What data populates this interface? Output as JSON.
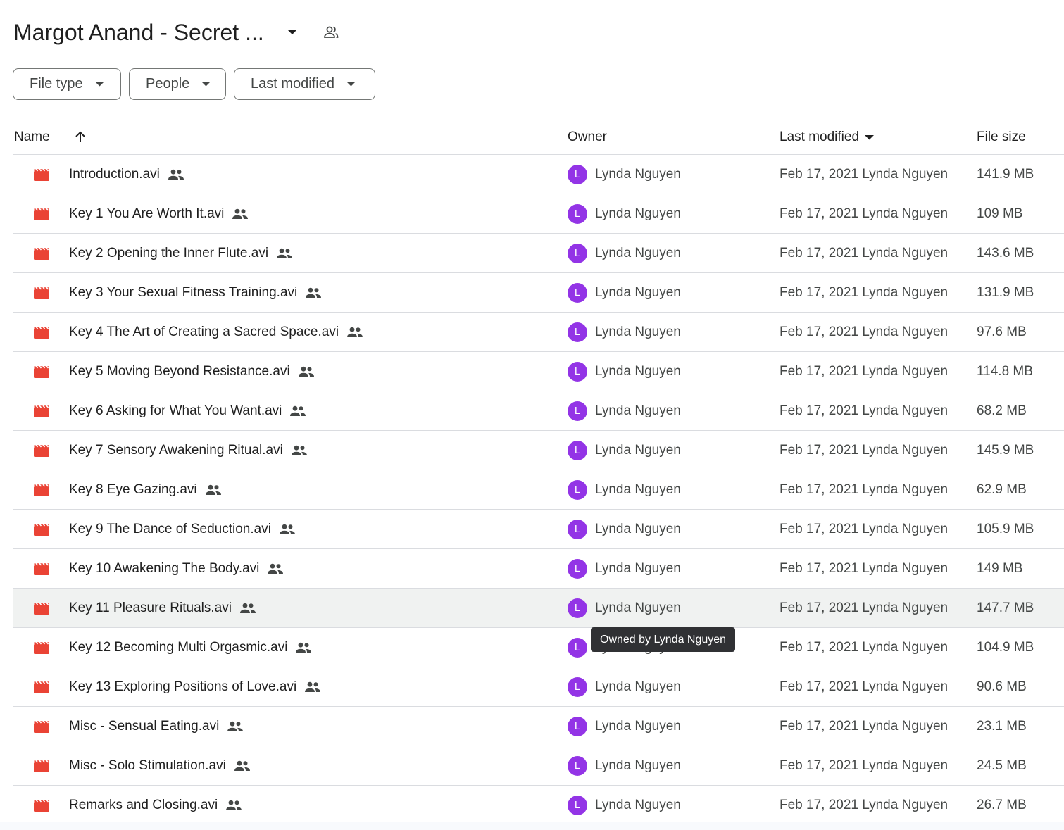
{
  "folder": {
    "title": "Margot Anand - Secret ..."
  },
  "filters": {
    "file_type": "File type",
    "people": "People",
    "last_modified": "Last modified"
  },
  "columns": {
    "name": "Name",
    "owner": "Owner",
    "last_modified": "Last modified",
    "file_size": "File size"
  },
  "colors": {
    "video_icon": "#ea4335",
    "avatar": "#9334e6",
    "tooltip_bg": "#303134"
  },
  "files": [
    {
      "name": "Introduction.avi",
      "owner_initial": "L",
      "owner": "Lynda Nguyen",
      "modified": "Feb 17, 2021 Lynda Nguyen",
      "size": "141.9 MB"
    },
    {
      "name": "Key 1 You Are Worth It.avi",
      "owner_initial": "L",
      "owner": "Lynda Nguyen",
      "modified": "Feb 17, 2021 Lynda Nguyen",
      "size": "109 MB"
    },
    {
      "name": "Key 2 Opening the Inner Flute.avi",
      "owner_initial": "L",
      "owner": "Lynda Nguyen",
      "modified": "Feb 17, 2021 Lynda Nguyen",
      "size": "143.6 MB"
    },
    {
      "name": "Key 3 Your Sexual Fitness Training.avi",
      "owner_initial": "L",
      "owner": "Lynda Nguyen",
      "modified": "Feb 17, 2021 Lynda Nguyen",
      "size": "131.9 MB"
    },
    {
      "name": "Key 4 The Art of Creating a Sacred Space.avi",
      "owner_initial": "L",
      "owner": "Lynda Nguyen",
      "modified": "Feb 17, 2021 Lynda Nguyen",
      "size": "97.6 MB"
    },
    {
      "name": "Key 5 Moving Beyond Resistance.avi",
      "owner_initial": "L",
      "owner": "Lynda Nguyen",
      "modified": "Feb 17, 2021 Lynda Nguyen",
      "size": "114.8 MB"
    },
    {
      "name": "Key 6 Asking for What You Want.avi",
      "owner_initial": "L",
      "owner": "Lynda Nguyen",
      "modified": "Feb 17, 2021 Lynda Nguyen",
      "size": "68.2 MB"
    },
    {
      "name": "Key 7 Sensory Awakening Ritual.avi",
      "owner_initial": "L",
      "owner": "Lynda Nguyen",
      "modified": "Feb 17, 2021 Lynda Nguyen",
      "size": "145.9 MB"
    },
    {
      "name": "Key 8 Eye Gazing.avi",
      "owner_initial": "L",
      "owner": "Lynda Nguyen",
      "modified": "Feb 17, 2021 Lynda Nguyen",
      "size": "62.9 MB"
    },
    {
      "name": "Key 9 The Dance of Seduction.avi",
      "owner_initial": "L",
      "owner": "Lynda Nguyen",
      "modified": "Feb 17, 2021 Lynda Nguyen",
      "size": "105.9 MB"
    },
    {
      "name": "Key 10 Awakening The Body.avi",
      "owner_initial": "L",
      "owner": "Lynda Nguyen",
      "modified": "Feb 17, 2021 Lynda Nguyen",
      "size": "149 MB"
    },
    {
      "name": "Key 11 Pleasure Rituals.avi",
      "owner_initial": "L",
      "owner": "Lynda Nguyen",
      "modified": "Feb 17, 2021 Lynda Nguyen",
      "size": "147.7 MB",
      "hovered": true
    },
    {
      "name": "Key 12 Becoming Multi Orgasmic.avi",
      "owner_initial": "L",
      "owner": "Lynda Nguyen",
      "modified": "Feb 17, 2021 Lynda Nguyen",
      "size": "104.9 MB"
    },
    {
      "name": "Key 13 Exploring Positions of Love.avi",
      "owner_initial": "L",
      "owner": "Lynda Nguyen",
      "modified": "Feb 17, 2021 Lynda Nguyen",
      "size": "90.6 MB"
    },
    {
      "name": "Misc - Sensual Eating.avi",
      "owner_initial": "L",
      "owner": "Lynda Nguyen",
      "modified": "Feb 17, 2021 Lynda Nguyen",
      "size": "23.1 MB"
    },
    {
      "name": "Misc - Solo Stimulation.avi",
      "owner_initial": "L",
      "owner": "Lynda Nguyen",
      "modified": "Feb 17, 2021 Lynda Nguyen",
      "size": "24.5 MB"
    },
    {
      "name": "Remarks and Closing.avi",
      "owner_initial": "L",
      "owner": "Lynda Nguyen",
      "modified": "Feb 17, 2021 Lynda Nguyen",
      "size": "26.7 MB"
    }
  ],
  "tooltip": {
    "text": "Owned by Lynda Nguyen"
  }
}
